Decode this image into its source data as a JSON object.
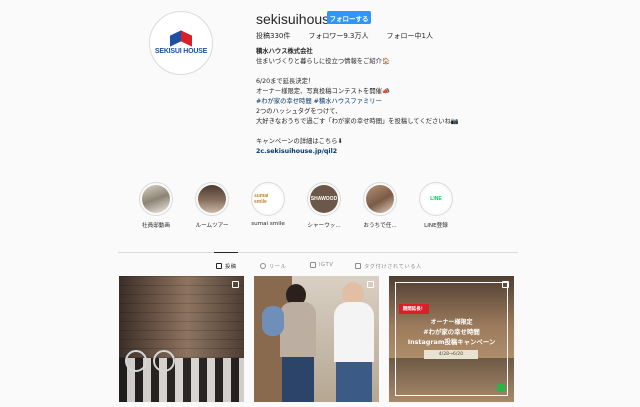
{
  "profile": {
    "avatar_text": "SEKISUI HOUSE",
    "username": "sekisuihouse",
    "follow_label": "フォローする",
    "stats": {
      "posts": "投稿330件",
      "followers": "フォロワー9.3万人",
      "following": "フォロー中1人"
    }
  },
  "bio": {
    "name": "積水ハウス株式会社",
    "lines": [
      "住まいづくりと暮らしに役立つ情報をご紹介🏠",
      "",
      "6/20まで延長決定！",
      "オーナー様限定、写真投稿コンテストを開催📣",
      "#わが家の幸せ時間 #積水ハウスファミリー",
      "2つのハッシュタグをつけて、",
      "大好きなおうちで過ごす「わが家の幸せ時間」を投稿してくださいね📷",
      "",
      "キャンペーンの詳細はこちら⬇",
      "2c.sekisuihouse.jp/qil2"
    ]
  },
  "highlights": [
    {
      "label": "社員邸動画",
      "inner": ""
    },
    {
      "label": "ルームツアー",
      "inner": ""
    },
    {
      "label": "sumai smile",
      "inner": "sumai smile"
    },
    {
      "label": "シャーウッ...",
      "inner": "SHAWOOD"
    },
    {
      "label": "おうちで任...",
      "inner": ""
    },
    {
      "label": "LINE登録",
      "inner": "LINE"
    }
  ],
  "tabs": [
    {
      "label": "投稿",
      "active": true
    },
    {
      "label": "リール",
      "active": false
    },
    {
      "label": "IGTV",
      "active": false
    },
    {
      "label": "タグ付けされている人",
      "active": false
    }
  ],
  "posts": {
    "p3_badge": "期間延長！",
    "p3_line1": "オーナー様限定",
    "p3_line2": "#わが家の幸せ時間",
    "p3_line3": "Instagram投稿キャンペーン",
    "p3_date": "4/28→6/20"
  }
}
